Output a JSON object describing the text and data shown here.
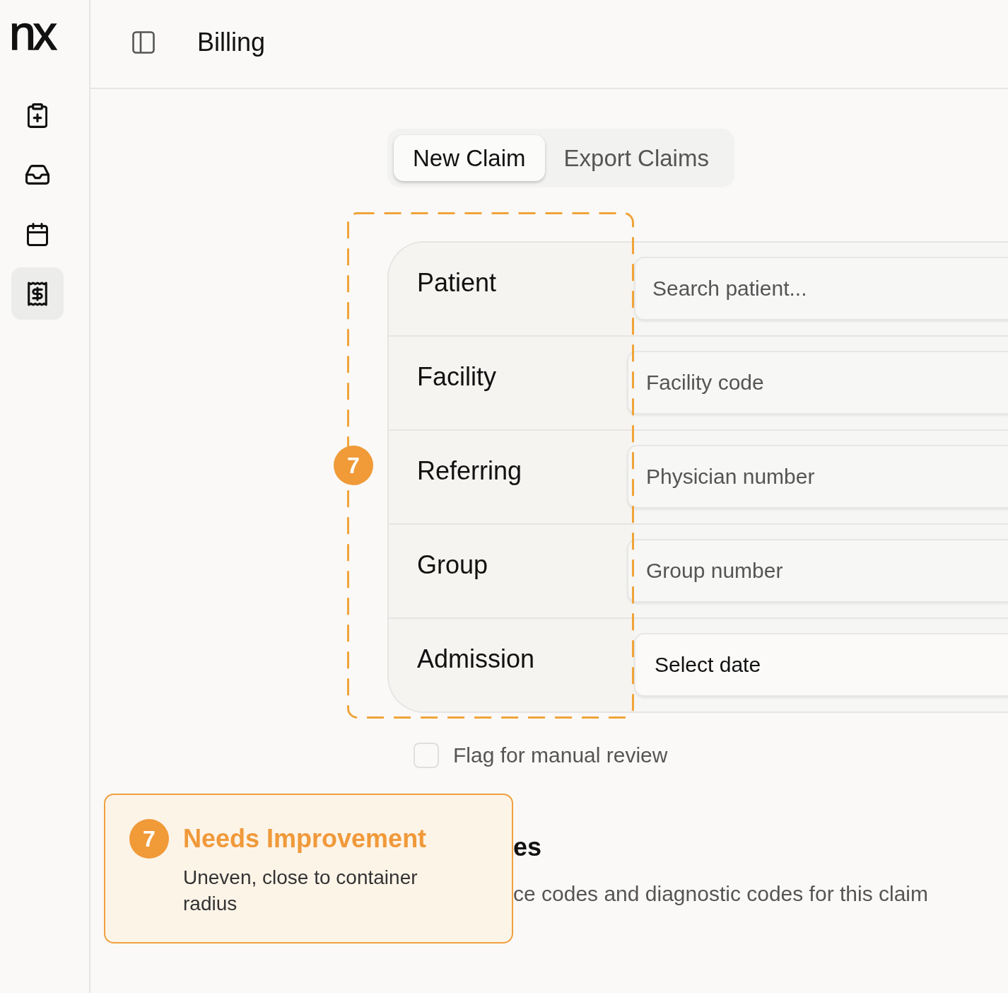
{
  "sidebar": {
    "logo": "nx",
    "items": [
      {
        "selected": false
      },
      {
        "selected": false
      },
      {
        "selected": false
      },
      {
        "selected": true
      }
    ]
  },
  "header": {
    "title": "Billing"
  },
  "tabs": [
    {
      "label": "New Claim",
      "selected": true
    },
    {
      "label": "Export Claims",
      "selected": false
    }
  ],
  "form": {
    "fields": [
      {
        "kind": "search",
        "label": "Patient",
        "placeholder": "Search patient..."
      },
      {
        "kind": "text",
        "label": "Facility",
        "placeholder": "Facility code"
      },
      {
        "kind": "text",
        "label": "Referring",
        "placeholder": "Physician number"
      },
      {
        "kind": "text",
        "label": "Group",
        "placeholder": "Group number"
      },
      {
        "kind": "date",
        "label": "Admission",
        "value": "Select date"
      }
    ]
  },
  "review_checkbox": {
    "label": "Flag for manual review",
    "checked": false
  },
  "codes_section": {
    "title": "es",
    "description": "ce codes and diagnostic codes for this claim"
  },
  "annotation_marker": {
    "number": "7"
  },
  "annotation_card": {
    "number": "7",
    "title": "Needs Improvement",
    "note": "Uneven, close to container radius"
  }
}
